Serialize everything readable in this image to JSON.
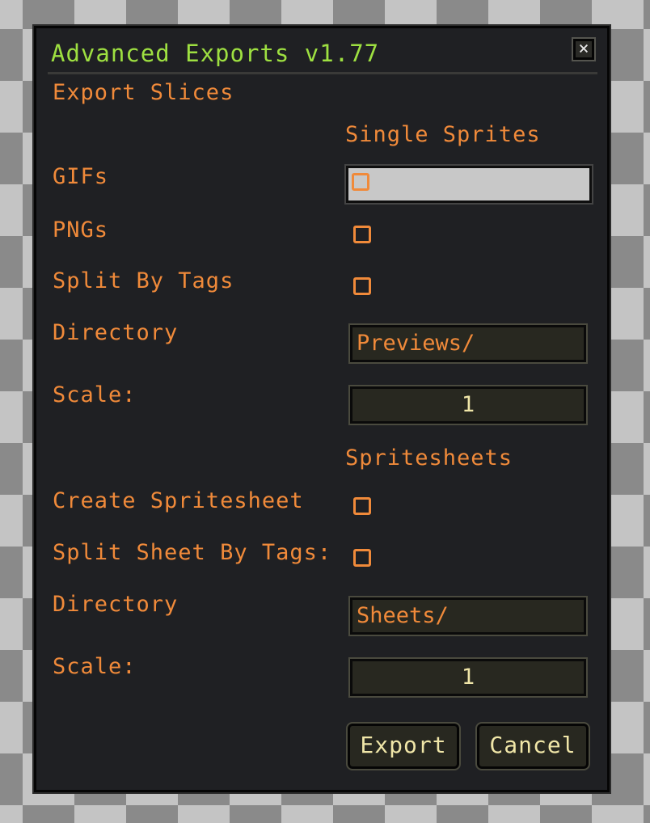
{
  "dialog": {
    "title": "Advanced Exports v1.77",
    "close_glyph": "×",
    "section": "Export Slices",
    "single": {
      "header": "Single Sprites",
      "gifs_label": "GIFs",
      "pngs_label": "PNGs",
      "split_tags_label": "Split By Tags",
      "directory_label": "Directory",
      "directory_value": "Previews/",
      "scale_label": "Scale:",
      "scale_value": "1"
    },
    "sheets": {
      "header": "Spritesheets",
      "create_label": "Create Spritesheet",
      "split_label": "Split Sheet By Tags:",
      "directory_label": "Directory",
      "directory_value": "Sheets/",
      "scale_label": "Scale:",
      "scale_value": "1"
    },
    "export_label": "Export",
    "cancel_label": "Cancel"
  },
  "colors": {
    "title": "#9ee041",
    "label": "#f08a3a",
    "value": "#f0e6a8",
    "panel": "#1f2023"
  }
}
